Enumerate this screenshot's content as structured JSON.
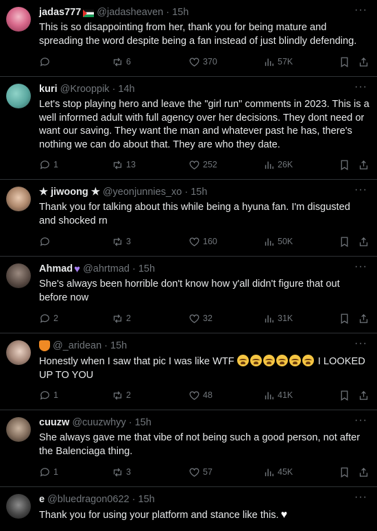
{
  "replies": [
    {
      "name": "jadas777",
      "handle": "@jadasheaven · 15h",
      "text": "This is so disappointing from her, thank you for being mature and spreading the word despite being a fan instead of just blindly defending.",
      "reply_count": "",
      "repost_count": "6",
      "like_count": "370",
      "view_count": "57K"
    },
    {
      "name": "kuri",
      "handle": "@Krooppik · 14h",
      "text": "Let's stop playing hero and leave the \"girl run\" comments in 2023. This is a well informed adult with full agency over her decisions. They dont need or want our saving. They want the man and whatever past he has, there's nothing we can do about that. They are who they date.",
      "reply_count": "1",
      "repost_count": "13",
      "like_count": "252",
      "view_count": "26K"
    },
    {
      "name": "★ jiwoong ★",
      "handle": "@yeonjunnies_xo · 15h",
      "text": "Thank you for talking about this while being a hyuna fan. I'm disgusted and shocked rn",
      "reply_count": "",
      "repost_count": "3",
      "like_count": "160",
      "view_count": "50K"
    },
    {
      "name": "Ahmad",
      "handle": "@ahrtmad · 15h",
      "text": "She's always been horrible don't know how y'all didn't figure that out before now",
      "reply_count": "2",
      "repost_count": "2",
      "like_count": "32",
      "view_count": "31K"
    },
    {
      "name": "",
      "handle": "@_aridean · 15h",
      "text_before": "Honestly when I saw that pic I was like WTF",
      "text_after": "I LOOKED UP TO YOU",
      "reply_count": "1",
      "repost_count": "2",
      "like_count": "48",
      "view_count": "41K"
    },
    {
      "name": "cuuzw",
      "handle": "@cuuzwhyy · 15h",
      "text": "She always gave me that vibe of not being such a good person, not after the Balenciaga thing.",
      "reply_count": "1",
      "repost_count": "3",
      "like_count": "57",
      "view_count": "45K"
    },
    {
      "name": "e",
      "handle": "@bluedragon0622 · 15h",
      "text": "Thank you for using your platform and stance like this."
    }
  ],
  "icons": {
    "reply": "reply-icon",
    "repost": "repost-icon",
    "like": "heart-icon",
    "views": "views-icon",
    "bookmark": "bookmark-icon",
    "share": "share-icon",
    "more": "more-icon"
  },
  "colors": {
    "background": "#000000",
    "text": "#e7e9ea",
    "secondary": "#71767b",
    "divider": "#2f3336"
  }
}
